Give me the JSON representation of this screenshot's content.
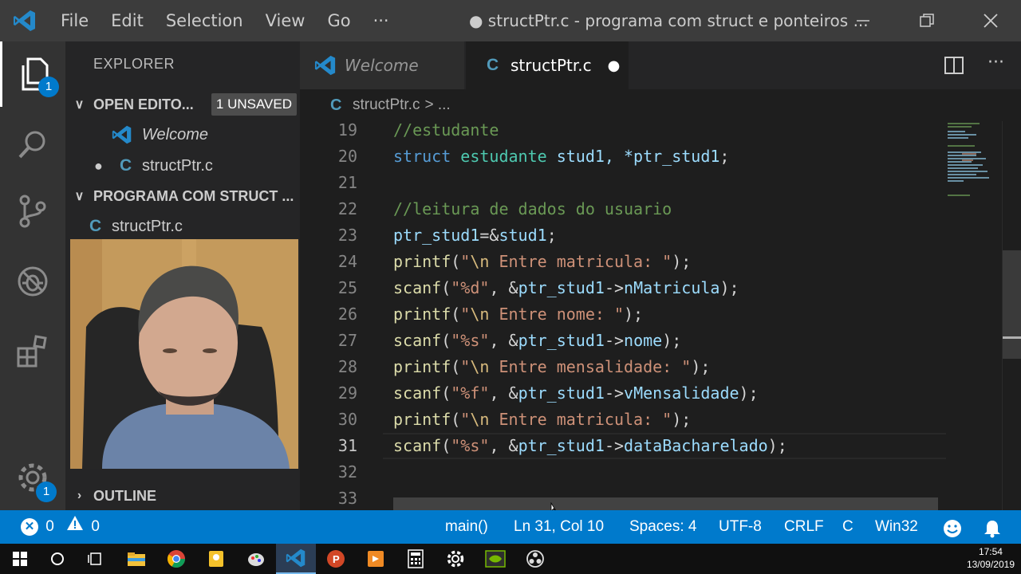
{
  "menu": [
    "File",
    "Edit",
    "Selection",
    "View",
    "Go",
    "···"
  ],
  "window_title": "● structPtr.c - programa com struct e ponteiros ...",
  "activity": {
    "explorer_badge": "1",
    "settings_badge": "1"
  },
  "sidebar": {
    "title": "EXPLORER",
    "open_editors_label": "OPEN EDITO...",
    "unsaved_label": "1 UNSAVED",
    "open_editors": [
      {
        "name": "Welcome",
        "italic": true,
        "icon": "vscode-icon"
      },
      {
        "name": "structPtr.c",
        "icon": "c-file-icon",
        "dirty": true
      }
    ],
    "project_label": "PROGRAMA COM STRUCT ...",
    "files": [
      {
        "name": "structPtr.c",
        "icon": "c-file-icon"
      }
    ],
    "outline_label": "OUTLINE"
  },
  "tabs": [
    {
      "label": "Welcome",
      "active": false
    },
    {
      "label": "structPtr.c",
      "active": true,
      "dirty": true
    }
  ],
  "breadcrumb": {
    "file": "structPtr.c",
    "rest": "> ..."
  },
  "editor": {
    "current_line": 31,
    "lines": [
      {
        "n": "19",
        "t": [
          [
            "//estudante",
            "#6a9955"
          ]
        ]
      },
      {
        "n": "20",
        "t": [
          [
            "struct ",
            "#569cd6"
          ],
          [
            "estudante ",
            "#4ec9b0"
          ],
          [
            "stud1, *",
            "#9cdcfe"
          ],
          [
            "ptr_stud1",
            "#9cdcfe"
          ],
          [
            ";",
            "#d4d4d4"
          ]
        ]
      },
      {
        "n": "21",
        "t": []
      },
      {
        "n": "22",
        "t": [
          [
            "//leitura de dados do usuario",
            "#6a9955"
          ]
        ]
      },
      {
        "n": "23",
        "t": [
          [
            "ptr_stud1",
            "#9cdcfe"
          ],
          [
            "=&",
            "#d4d4d4"
          ],
          [
            "stud1",
            "#9cdcfe"
          ],
          [
            ";",
            "#d4d4d4"
          ]
        ]
      },
      {
        "n": "24",
        "t": [
          [
            "printf",
            "#dcdcaa"
          ],
          [
            "(",
            "#d4d4d4"
          ],
          [
            "\"",
            "#ce9178"
          ],
          [
            "\\n",
            "#d7ba7d"
          ],
          [
            " Entre matricula: \"",
            "#ce9178"
          ],
          [
            ");",
            "#d4d4d4"
          ]
        ]
      },
      {
        "n": "25",
        "t": [
          [
            "scanf",
            "#dcdcaa"
          ],
          [
            "(",
            "#d4d4d4"
          ],
          [
            "\"%d\"",
            "#ce9178"
          ],
          [
            ", &",
            "#d4d4d4"
          ],
          [
            "ptr_stud1",
            "#9cdcfe"
          ],
          [
            "->",
            "#d4d4d4"
          ],
          [
            "nMatricula",
            "#9cdcfe"
          ],
          [
            ");",
            "#d4d4d4"
          ]
        ]
      },
      {
        "n": "26",
        "t": [
          [
            "printf",
            "#dcdcaa"
          ],
          [
            "(",
            "#d4d4d4"
          ],
          [
            "\"",
            "#ce9178"
          ],
          [
            "\\n",
            "#d7ba7d"
          ],
          [
            " Entre nome: \"",
            "#ce9178"
          ],
          [
            ");",
            "#d4d4d4"
          ]
        ]
      },
      {
        "n": "27",
        "t": [
          [
            "scanf",
            "#dcdcaa"
          ],
          [
            "(",
            "#d4d4d4"
          ],
          [
            "\"%s\"",
            "#ce9178"
          ],
          [
            ", &",
            "#d4d4d4"
          ],
          [
            "ptr_stud1",
            "#9cdcfe"
          ],
          [
            "->",
            "#d4d4d4"
          ],
          [
            "nome",
            "#9cdcfe"
          ],
          [
            ");",
            "#d4d4d4"
          ]
        ]
      },
      {
        "n": "28",
        "t": [
          [
            "printf",
            "#dcdcaa"
          ],
          [
            "(",
            "#d4d4d4"
          ],
          [
            "\"",
            "#ce9178"
          ],
          [
            "\\n",
            "#d7ba7d"
          ],
          [
            " Entre mensalidade: \"",
            "#ce9178"
          ],
          [
            ");",
            "#d4d4d4"
          ]
        ]
      },
      {
        "n": "29",
        "t": [
          [
            "scanf",
            "#dcdcaa"
          ],
          [
            "(",
            "#d4d4d4"
          ],
          [
            "\"%f\"",
            "#ce9178"
          ],
          [
            ", &",
            "#d4d4d4"
          ],
          [
            "ptr_stud1",
            "#9cdcfe"
          ],
          [
            "->",
            "#d4d4d4"
          ],
          [
            "vMensalidade",
            "#9cdcfe"
          ],
          [
            ");",
            "#d4d4d4"
          ]
        ]
      },
      {
        "n": "30",
        "t": [
          [
            "printf",
            "#dcdcaa"
          ],
          [
            "(",
            "#d4d4d4"
          ],
          [
            "\"",
            "#ce9178"
          ],
          [
            "\\n",
            "#d7ba7d"
          ],
          [
            " Entre matricula: \"",
            "#ce9178"
          ],
          [
            ");",
            "#d4d4d4"
          ]
        ]
      },
      {
        "n": "31",
        "t": [
          [
            "scanf",
            "#dcdcaa"
          ],
          [
            "(",
            "#d4d4d4"
          ],
          [
            "\"%s\"",
            "#ce9178"
          ],
          [
            ", &",
            "#d4d4d4"
          ],
          [
            "ptr_stud1",
            "#9cdcfe"
          ],
          [
            "->",
            "#d4d4d4"
          ],
          [
            "dataBacharelado",
            "#9cdcfe"
          ],
          [
            ");",
            "#d4d4d4"
          ]
        ]
      },
      {
        "n": "32",
        "t": []
      },
      {
        "n": "33",
        "t": []
      }
    ]
  },
  "status": {
    "errors": "0",
    "warnings": "0",
    "scope": "main()",
    "position": "Ln 31, Col 10",
    "spaces": "Spaces: 4",
    "encoding": "UTF-8",
    "eol": "CRLF",
    "language": "C",
    "platform": "Win32"
  },
  "taskbar": {
    "time": "17:54",
    "date": "13/09/2019"
  },
  "colors": {
    "accent": "#007acc",
    "editor_bg": "#1e1e1e",
    "sidebar_bg": "#252526",
    "activity_bg": "#333333"
  }
}
